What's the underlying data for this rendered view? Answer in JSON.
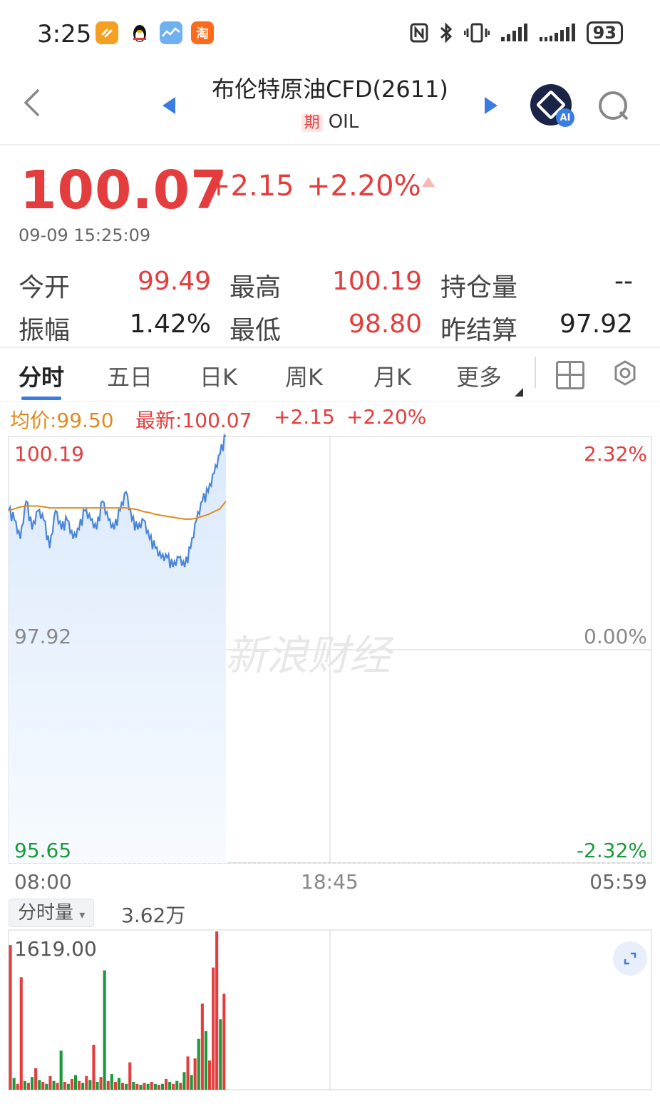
{
  "status_bar": {
    "time": "3:25",
    "app_icons": [
      "app-orange-icon",
      "qq-penguin-icon",
      "stock-chart-icon",
      "taobao-icon"
    ],
    "taobao_glyph": "淘",
    "system_icons": [
      "nfc-icon",
      "bluetooth-icon",
      "vibrate-icon",
      "signal-icon",
      "signal-icon"
    ],
    "battery": "93"
  },
  "header": {
    "title": "布伦特原油CFD(2611)",
    "tag": "期",
    "code": "OIL",
    "ai_label": "AI"
  },
  "quote": {
    "price": "100.07",
    "change": "+2.15",
    "change_pct": "+2.20%",
    "timestamp": "09-09 15:25:09",
    "stats": [
      {
        "label": "今开",
        "value": "99.49"
      },
      {
        "label": "最高",
        "value": "100.19"
      },
      {
        "label": "持仓量",
        "value": "--"
      },
      {
        "label": "振幅",
        "value": "1.42%"
      },
      {
        "label": "最低",
        "value": "98.80"
      },
      {
        "label": "昨结算",
        "value": "97.92"
      }
    ]
  },
  "tabs": [
    "分时",
    "五日",
    "日K",
    "周K",
    "月K",
    "更多"
  ],
  "active_tab": "分时",
  "info_line": {
    "avg": "均价:99.50",
    "latest": "最新:100.07",
    "change": "+2.15",
    "pct": "+2.20%"
  },
  "chart_data": {
    "type": "line",
    "watermark": "新浪财经",
    "y_labels_left": [
      "100.19",
      "97.92",
      "95.65"
    ],
    "y_labels_right": [
      "2.32%",
      "0.00%",
      "-2.32%"
    ],
    "x_labels": [
      "08:00",
      "18:45",
      "05:59"
    ],
    "ylim": [
      95.65,
      100.19
    ],
    "prev_settle": 97.92,
    "series": [
      {
        "values": [
          99.4,
          99.3,
          99.1,
          99.5,
          99.2,
          99.4,
          99.3,
          99.0,
          99.4,
          99.2,
          99.3,
          99.1,
          99.2,
          99.4,
          99.3,
          99.2,
          99.5,
          99.3,
          99.2,
          99.4,
          99.6,
          99.3,
          99.2,
          99.3,
          99.1,
          99.0,
          98.9,
          98.9,
          98.8,
          98.9,
          98.8,
          99.0,
          99.3,
          99.5,
          99.6,
          99.8,
          100.0,
          100.19
        ]
      },
      {
        "values": [
          99.4,
          99.42,
          99.44,
          99.45,
          99.45,
          99.45,
          99.44,
          99.43,
          99.43,
          99.43,
          99.43,
          99.43,
          99.43,
          99.43,
          99.43,
          99.43,
          99.43,
          99.43,
          99.43,
          99.43,
          99.43,
          99.42,
          99.41,
          99.39,
          99.38,
          99.36,
          99.35,
          99.34,
          99.33,
          99.32,
          99.31,
          99.31,
          99.32,
          99.34,
          99.36,
          99.39,
          99.42,
          99.5
        ]
      }
    ],
    "session_fraction": 0.338
  },
  "volume": {
    "selector": "分时量",
    "total": "3.62万",
    "max_label": "1619.00",
    "bars": [
      {
        "v": 1480,
        "c": "red"
      },
      {
        "v": 120,
        "c": "green"
      },
      {
        "v": 60,
        "c": "red"
      },
      {
        "v": 1150,
        "c": "red"
      },
      {
        "v": 90,
        "c": "green"
      },
      {
        "v": 70,
        "c": "red"
      },
      {
        "v": 130,
        "c": "green"
      },
      {
        "v": 220,
        "c": "red"
      },
      {
        "v": 100,
        "c": "green"
      },
      {
        "v": 80,
        "c": "red"
      },
      {
        "v": 60,
        "c": "green"
      },
      {
        "v": 140,
        "c": "red"
      },
      {
        "v": 90,
        "c": "green"
      },
      {
        "v": 70,
        "c": "red"
      },
      {
        "v": 400,
        "c": "green"
      },
      {
        "v": 80,
        "c": "red"
      },
      {
        "v": 60,
        "c": "green"
      },
      {
        "v": 110,
        "c": "red"
      },
      {
        "v": 150,
        "c": "green"
      },
      {
        "v": 90,
        "c": "red"
      },
      {
        "v": 70,
        "c": "green"
      },
      {
        "v": 140,
        "c": "red"
      },
      {
        "v": 100,
        "c": "green"
      },
      {
        "v": 460,
        "c": "red"
      },
      {
        "v": 80,
        "c": "green"
      },
      {
        "v": 130,
        "c": "red"
      },
      {
        "v": 1220,
        "c": "green"
      },
      {
        "v": 90,
        "c": "red"
      },
      {
        "v": 160,
        "c": "green"
      },
      {
        "v": 80,
        "c": "red"
      },
      {
        "v": 120,
        "c": "green"
      },
      {
        "v": 70,
        "c": "red"
      },
      {
        "v": 60,
        "c": "green"
      },
      {
        "v": 280,
        "c": "red"
      },
      {
        "v": 80,
        "c": "green"
      },
      {
        "v": 60,
        "c": "red"
      },
      {
        "v": 50,
        "c": "green"
      },
      {
        "v": 70,
        "c": "red"
      },
      {
        "v": 60,
        "c": "green"
      },
      {
        "v": 80,
        "c": "red"
      },
      {
        "v": 60,
        "c": "green"
      },
      {
        "v": 50,
        "c": "red"
      },
      {
        "v": 60,
        "c": "green"
      },
      {
        "v": 110,
        "c": "red"
      },
      {
        "v": 80,
        "c": "green"
      },
      {
        "v": 60,
        "c": "red"
      },
      {
        "v": 90,
        "c": "green"
      },
      {
        "v": 70,
        "c": "red"
      },
      {
        "v": 180,
        "c": "green"
      },
      {
        "v": 340,
        "c": "red"
      },
      {
        "v": 150,
        "c": "green"
      },
      {
        "v": 320,
        "c": "red"
      },
      {
        "v": 520,
        "c": "green"
      },
      {
        "v": 880,
        "c": "red"
      },
      {
        "v": 600,
        "c": "green"
      },
      {
        "v": 300,
        "c": "red"
      },
      {
        "v": 1250,
        "c": "red"
      },
      {
        "v": 1619,
        "c": "red"
      },
      {
        "v": 720,
        "c": "green"
      },
      {
        "v": 980,
        "c": "red"
      }
    ]
  },
  "colors": {
    "up": "#e43d3d",
    "down": "#1a9a3a",
    "price_line": "#4a86d8",
    "avg_line": "#e08a1e",
    "accent": "#3a7ce0"
  }
}
